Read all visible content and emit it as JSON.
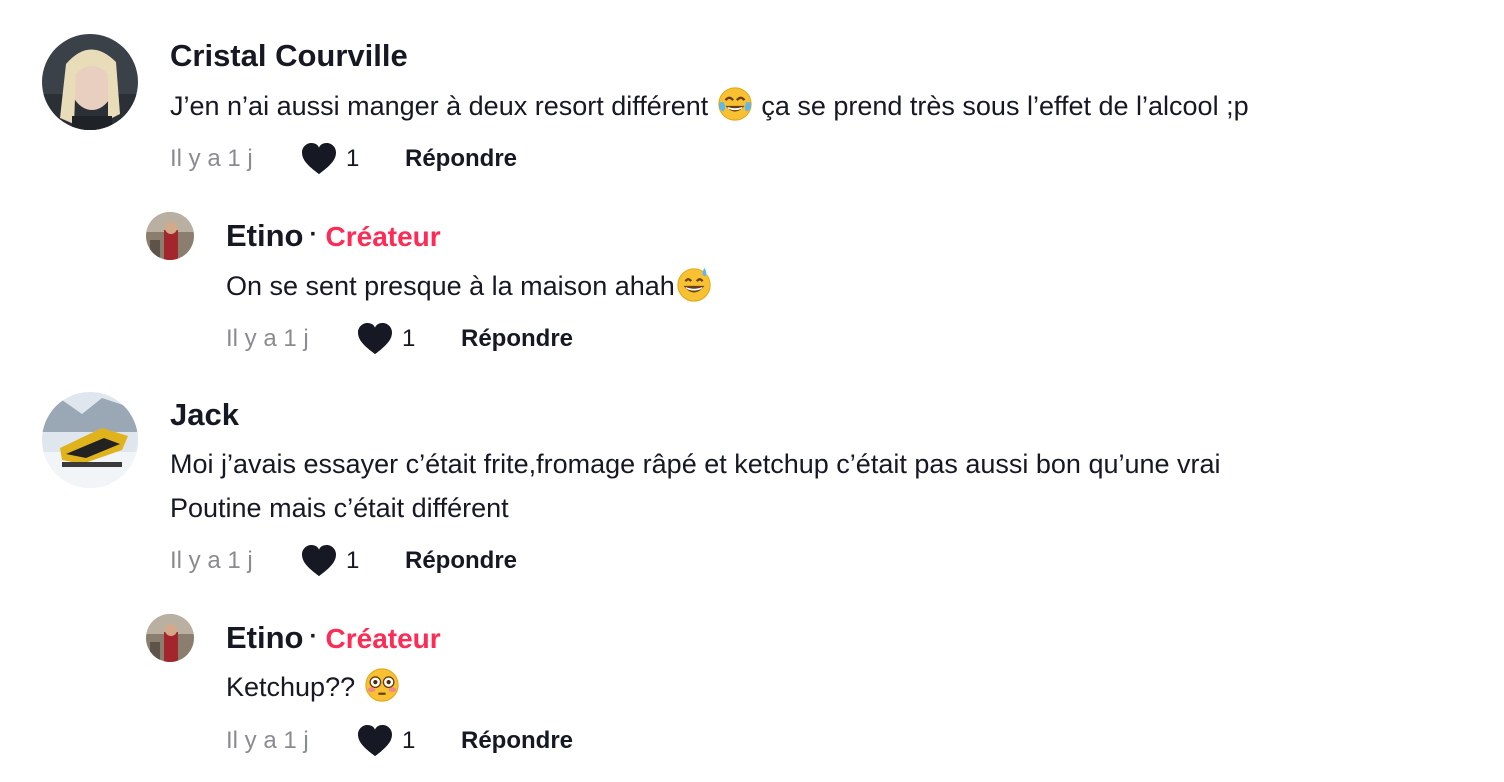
{
  "comments": [
    {
      "author": "Cristal Courville",
      "text": "J’en n’ai aussi manger à deux resort différent ",
      "text_after": " ça se prend très sous l’effet de l’alcool ;p",
      "emoji": "tears-of-joy",
      "time": "Il y a 1 j",
      "likes": "1",
      "reply_label": "Répondre"
    },
    {
      "author": "Etino",
      "creator_label": "Créateur",
      "creator_dot": "·",
      "text": "On se sent presque à la maison ahah",
      "emoji": "grinning-sweat",
      "time": "Il y a 1 j",
      "likes": "1",
      "reply_label": "Répondre"
    },
    {
      "author": "Jack",
      "text_line1": "Moi j’avais essayer c’était frite,fromage râpé et ketchup c’était pas aussi bon qu’une vrai",
      "text_line2": "Poutine mais c’était différent",
      "time": "Il y a 1 j",
      "likes": "1",
      "reply_label": "Répondre"
    },
    {
      "author": "Etino",
      "creator_label": "Créateur",
      "creator_dot": "·",
      "text": "Ketchup?? ",
      "emoji": "flushed-face",
      "time": "Il y a 1 j",
      "likes": "1",
      "reply_label": "Répondre"
    }
  ],
  "colors": {
    "creator": "#fe2c55",
    "text": "#161823",
    "muted": "#8a8b91"
  }
}
